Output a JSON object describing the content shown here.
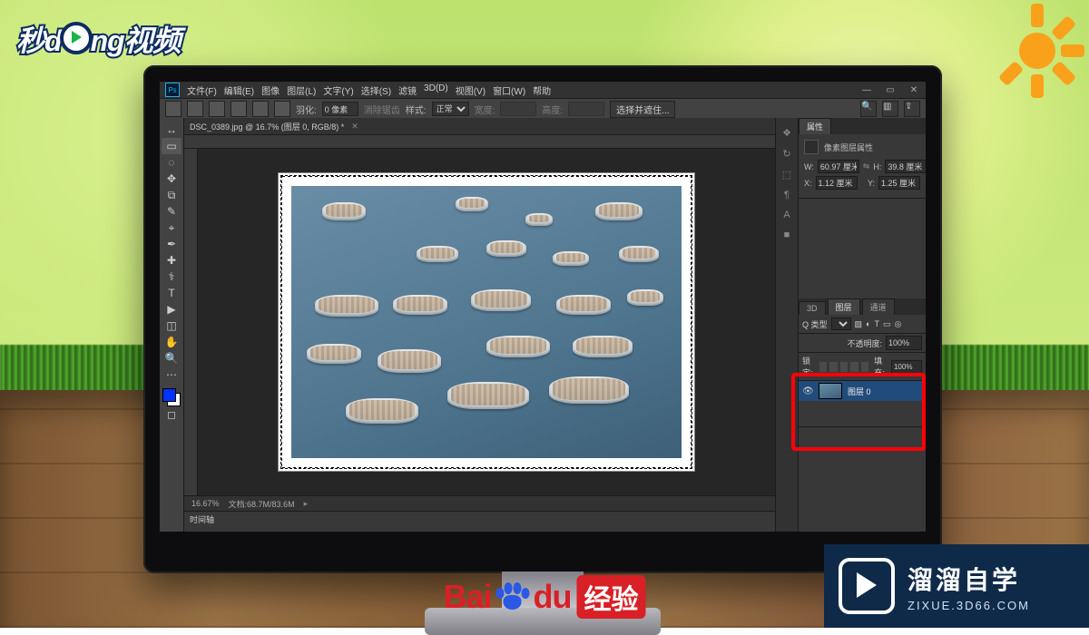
{
  "watermarks": {
    "top_logo": "秒dong视频",
    "baidu_brand": "Bai",
    "baidu_brand2": "du",
    "baidu_label": "经验",
    "zixue_title": "溜溜自学",
    "zixue_sub": "ZIXUE.3D66.COM"
  },
  "ps": {
    "menu": [
      "文件(F)",
      "编辑(E)",
      "图像",
      "图层(L)",
      "文字(Y)",
      "选择(S)",
      "滤镜",
      "3D(D)",
      "视图(V)",
      "窗口(W)",
      "帮助"
    ],
    "window_controls": [
      "—",
      "▭",
      "✕"
    ],
    "options_bar": {
      "feather_label": "羽化:",
      "feather_value": "0 像素",
      "antialias": "消除锯齿",
      "style_label": "样式:",
      "style_value": "正常",
      "width_label": "宽度:",
      "height_label": "高度:",
      "refine_edge": "选择并遮住..."
    },
    "document_tab": "DSC_0389.jpg @ 16.7% (图层 0, RGB/8) *",
    "status": {
      "zoom": "16.67%",
      "docinfo": "文档:68.7M/83.6M"
    },
    "timeline_tab": "时间轴",
    "right_strip_icons": [
      "❖",
      "↻",
      "⬚",
      "¶",
      "A",
      "■"
    ],
    "properties": {
      "tab": "属性",
      "header": "像素图层属性",
      "w_label": "W:",
      "w_val": "60.97 厘米",
      "link": "⇋",
      "h_label": "H:",
      "h_val": "39.8 厘米",
      "x_label": "X:",
      "x_val": "1.12 厘米",
      "y_label": "Y:",
      "y_val": "1.25 厘米"
    },
    "layers": {
      "tabs": [
        "3D",
        "图层",
        "通道"
      ],
      "kind_label": "Q 类型",
      "kind_value": "",
      "opacity_label": "不透明度:",
      "opacity_val": "100%",
      "lock_label": "锁定:",
      "fill_label": "填充:",
      "fill_val": "100%",
      "layer0": {
        "name": "图层 0"
      }
    },
    "tools": [
      "↔",
      "▭",
      "◌",
      "✥",
      "⧉",
      "✎",
      "⌖",
      "✒",
      "✚",
      "⚕",
      "T",
      "▶",
      "◫",
      "✋",
      "🔍",
      "⋯"
    ]
  }
}
